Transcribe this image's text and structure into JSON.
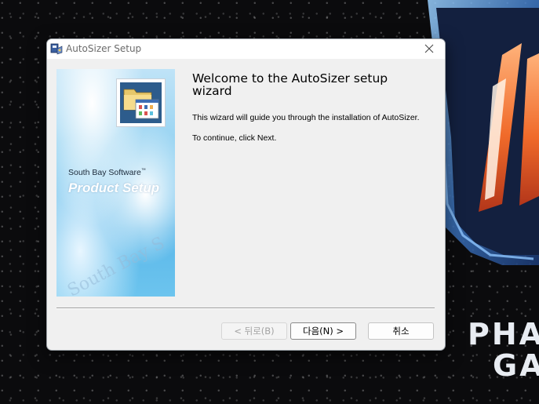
{
  "window": {
    "title": "AutoSizer Setup",
    "close_glyph": "✕"
  },
  "side_panel": {
    "vendor": "South Bay Software",
    "trademark": "™",
    "heading": "Product Setup",
    "watermark": "South Bay S"
  },
  "main": {
    "heading": "Welcome to the AutoSizer setup wizard",
    "paragraph_1": "This wizard will guide you through the installation of AutoSizer.",
    "paragraph_2": "To continue, click Next."
  },
  "buttons": {
    "back": "< 뒤로(B)",
    "next": "다음(N) >",
    "cancel": "취소"
  },
  "background": {
    "brand_line_1": "PHA",
    "brand_line_2": "GA"
  },
  "icons": {
    "app": "installer-icon",
    "close": "close-icon",
    "product": "folder-icon"
  },
  "colors": {
    "desktop": "#0b0b0d",
    "dialog_bg": "#f0f0f0",
    "panel_blue": "#5ab7e9",
    "shield_orange": "#f07a3a"
  }
}
